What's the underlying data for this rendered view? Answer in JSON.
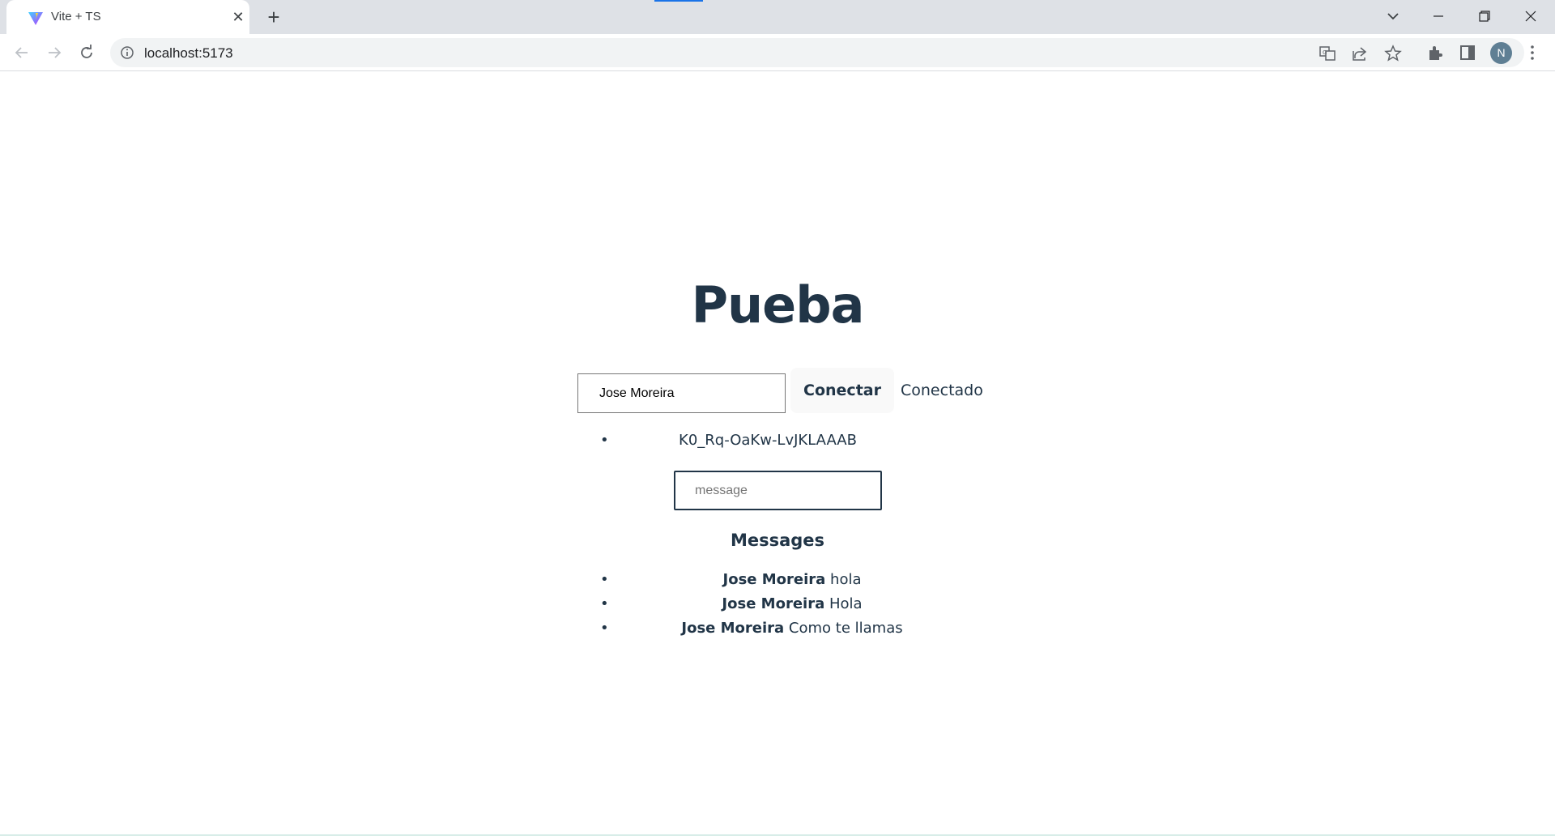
{
  "browser": {
    "tab": {
      "title": "Vite + TS"
    },
    "new_tab": "+",
    "address": {
      "url": "localhost:5173"
    },
    "profile_initial": "N"
  },
  "app": {
    "title": "Pueba",
    "name_input": {
      "value": "Jose Moreira"
    },
    "connect_button": "Conectar",
    "status": "Conectado",
    "client_ids": [
      "K0_Rq-OaKw-LvJKLAAAB"
    ],
    "message_input": {
      "placeholder": "message",
      "value": ""
    },
    "messages_heading": "Messages",
    "messages": [
      {
        "author": "Jose Moreira",
        "text": "hola"
      },
      {
        "author": "Jose Moreira",
        "text": "Hola"
      },
      {
        "author": "Jose Moreira",
        "text": "Como te llamas"
      }
    ]
  },
  "colors": {
    "text": "#213547",
    "button_bg": "#f9f9f9",
    "tabstrip_bg": "#dee1e6",
    "omnibox_bg": "#f1f3f4",
    "accent": "#1a73e8"
  }
}
